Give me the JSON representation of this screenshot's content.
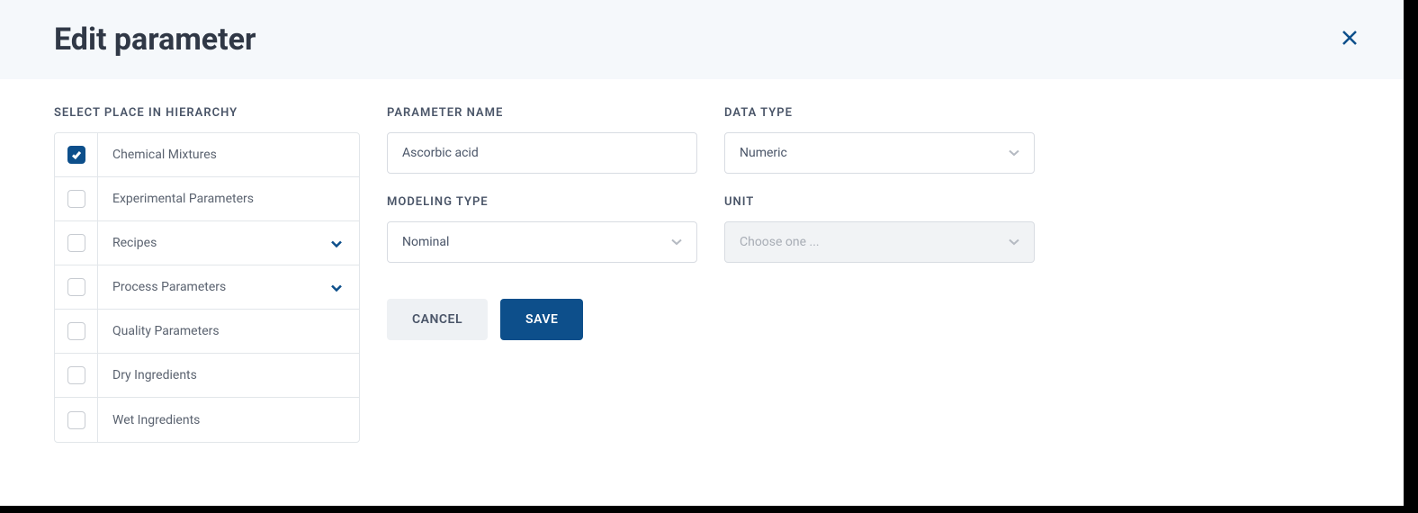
{
  "header": {
    "title": "Edit parameter"
  },
  "hierarchy": {
    "label": "SELECT PLACE IN HIERARCHY",
    "items": [
      {
        "label": "Chemical Mixtures",
        "checked": true,
        "expandable": false
      },
      {
        "label": "Experimental Parameters",
        "checked": false,
        "expandable": false
      },
      {
        "label": "Recipes",
        "checked": false,
        "expandable": true
      },
      {
        "label": "Process Parameters",
        "checked": false,
        "expandable": true
      },
      {
        "label": "Quality Parameters",
        "checked": false,
        "expandable": false
      },
      {
        "label": "Dry Ingredients",
        "checked": false,
        "expandable": false
      },
      {
        "label": "Wet Ingredients",
        "checked": false,
        "expandable": false
      }
    ]
  },
  "fields": {
    "parameter_name": {
      "label": "PARAMETER NAME",
      "value": "Ascorbic acid"
    },
    "data_type": {
      "label": "DATA TYPE",
      "value": "Numeric"
    },
    "modeling_type": {
      "label": "MODELING TYPE",
      "value": "Nominal"
    },
    "unit": {
      "label": "UNIT",
      "placeholder": "Choose one ..."
    }
  },
  "buttons": {
    "cancel": "CANCEL",
    "save": "SAVE"
  }
}
